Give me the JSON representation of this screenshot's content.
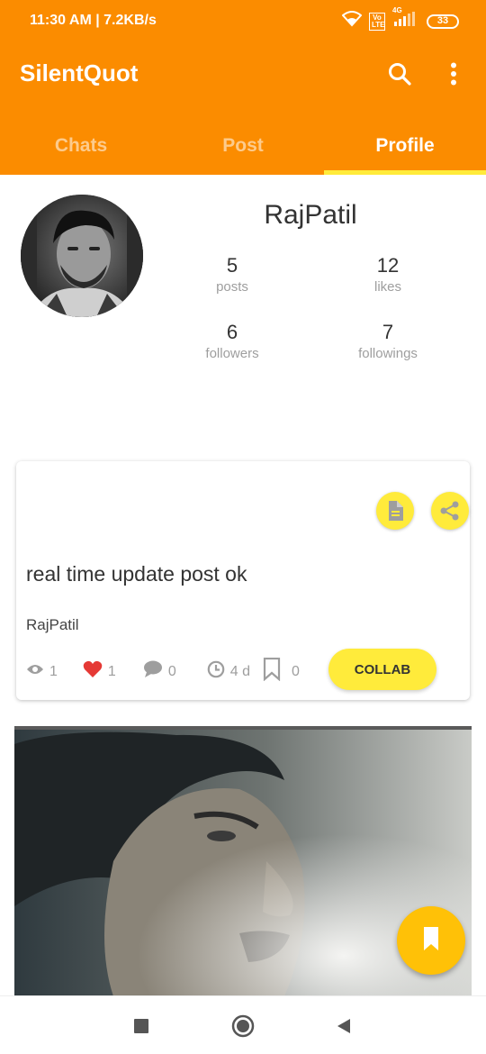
{
  "status_bar": {
    "time_speed": "11:30 AM | 7.2KB/s",
    "volte": "Vo LTE",
    "network": "4G",
    "battery": "33"
  },
  "app_bar": {
    "title": "SilentQuot",
    "search_icon": "search-icon",
    "more_icon": "more-vert-icon"
  },
  "tabs": [
    {
      "label": "Chats",
      "active": false
    },
    {
      "label": "Post",
      "active": false
    },
    {
      "label": "Profile",
      "active": true
    }
  ],
  "profile": {
    "name": "RajPatil",
    "stats": [
      {
        "value": "5",
        "label": "posts"
      },
      {
        "value": "12",
        "label": "likes"
      },
      {
        "value": "6",
        "label": "followers"
      },
      {
        "value": "7",
        "label": "followings"
      }
    ]
  },
  "post": {
    "text": "real time update post ok",
    "author": "RajPatil",
    "views": "1",
    "likes": "1",
    "comments": "0",
    "age": "4 d",
    "bookmarks": "0",
    "collab_label": "COLLAB"
  },
  "colors": {
    "primary": "#fb8c00",
    "accent": "#ffeb3b",
    "fab": "#ffc107",
    "heart": "#e53935"
  }
}
